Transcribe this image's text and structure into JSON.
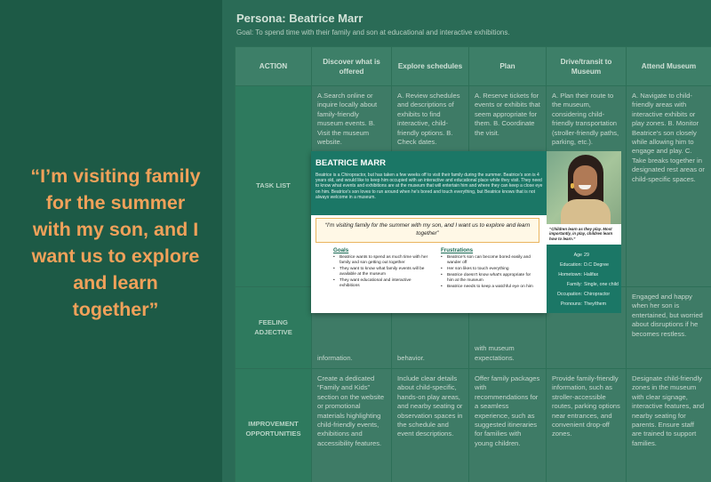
{
  "quote": {
    "lines": [
      "“I’m visiting family",
      "for the summer",
      "with my son, and I",
      "want us to explore",
      "and learn",
      "together”"
    ]
  },
  "journey": {
    "title": "Persona: Beatrice Marr",
    "goal": "Goal: To spend time with their family and son at educational and interactive exhibitions.",
    "header_action": "ACTION",
    "stages": [
      "Discover what is offered",
      "Explore schedules",
      "Plan",
      "Drive/transit to Museum",
      "Attend  Museum"
    ],
    "row_labels": [
      "TASK LIST",
      "FEELING ADJECTIVE",
      "IMPROVEMENT OPPORTUNITIES"
    ],
    "task_list": [
      "A.Search online or inquire locally about family-friendly museum events. B. Visit the museum website.",
      "A. Review schedules and descriptions of exhibits to find interactive, child-friendly options. B. Check dates.",
      "A. Reserve tickets for events or exhibits that seem appropriate for them. B. Coordinate the visit.",
      "A. Plan their route to the museum, considering child-friendly transportation (stroller-friendly paths, parking, etc.).",
      "A. Navigate to child-friendly areas with interactive exhibits or play zones. B. Monitor Beatrice's son closely while allowing him to engage and play. C. Take breaks together in designated rest areas or child-specific spaces."
    ],
    "feeling": [
      "information.",
      "behavior.",
      "with museum expectations.",
      "",
      "Engaged and happy when her son is entertained, but worried about disruptions if he becomes restless."
    ],
    "improvement": [
      "Create a dedicated “Family and Kids” section on the website or promotional materials highlighting child-friendly events, exhibitions and accessibility features.",
      "Include clear details about child-specific, hands-on play areas, and nearby seating or observation spaces in the schedule and event descriptions.",
      "Offer family packages with recommendations for a seamless experience, such as suggested itineraries for families with young children.",
      "Provide family-friendly information, such as stroller-accessible routes, parking options near entrances, and convenient drop-off zones.",
      "Designate child-friendly zones in the museum with clear signage, interactive features, and nearby seating for parents. Ensure staff are trained to support families."
    ]
  },
  "persona": {
    "name": "BEATRICE MARR",
    "bio": "Beatrice is a Chiropractor, but has taken a few weeks off to visit their family during the summer. Beatrice's son is 4 years old, and would like to keep him occupied with an interactive and educational place while they visit. They need to know what events and exhibitions are at the museum that will entertain him and where they can keep a close eye on him. Beatrice's son loves to run around when he's bored and touch everything, but Beatrice knows that is not always welcome in a museum.",
    "quote": "“I'm visiting family for the summer with my son, and I want us to explore and learn together”",
    "goals_label": "Goals",
    "goals": [
      "Beatrice wants to spend as much time with her family and son getting out together",
      "They want to know what family events will be available at the museum",
      "They want educational and interactive exhibitions"
    ],
    "frustrations_label": "Frustrations",
    "frustrations": [
      "Beatrice's son can become bored easily and wander off",
      "Her son likes to touch everything",
      "Beatrice doesn't know what's appropriate for him at the museum",
      "Beatrice needs to keep a watchful eye on him"
    ],
    "photo_caption": "“Children learn as they play. Most importantly, in play, children learn how to learn.”",
    "info": [
      {
        "label": "Age",
        "value": "29"
      },
      {
        "label": "Education:",
        "value": "D.C Degree"
      },
      {
        "label": "Hometown:",
        "value": "Halifax"
      },
      {
        "label": "Family:",
        "value": "Single, one child"
      },
      {
        "label": "Occupation:",
        "value": "Chiropractor"
      },
      {
        "label": "Pronouns:",
        "value": "They/them"
      }
    ]
  }
}
